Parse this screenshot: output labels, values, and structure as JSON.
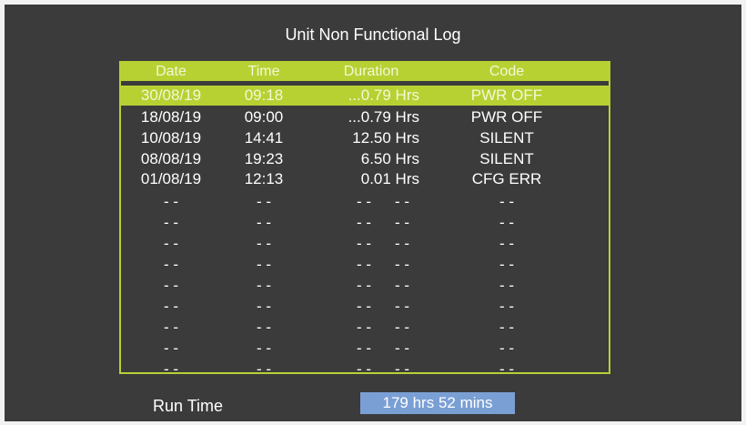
{
  "title": "Unit Non Functional Log",
  "columns": [
    "Date",
    "Time",
    "Duration",
    "Code"
  ],
  "selected_row_index": 0,
  "entries": [
    {
      "date": "30/08/19",
      "time": "09:18",
      "duration": "...0.79 Hrs",
      "code": "PWR OFF"
    },
    {
      "date": "18/08/19",
      "time": "09:00",
      "duration": "...0.79 Hrs",
      "code": "PWR OFF"
    },
    {
      "date": "10/08/19",
      "time": "14:41",
      "duration": "12.50 Hrs",
      "code": "SILENT"
    },
    {
      "date": "08/08/19",
      "time": "19:23",
      "duration": "6.50 Hrs",
      "code": "SILENT"
    },
    {
      "date": "01/08/19",
      "time": "12:13",
      "duration": "0.01 Hrs",
      "code": "CFG ERR"
    }
  ],
  "empty_entry": {
    "date": "- -",
    "time": "- -",
    "duration_a": "- -",
    "duration_b": "- -",
    "code": "- -"
  },
  "empty_rows_count": 9,
  "run_time": {
    "label": "Run Time",
    "value": "179 hrs 52 mins"
  },
  "colors": {
    "accent": "#b7d133",
    "background": "#3b3b3b",
    "run_time_highlight": "#7a9fd4"
  }
}
